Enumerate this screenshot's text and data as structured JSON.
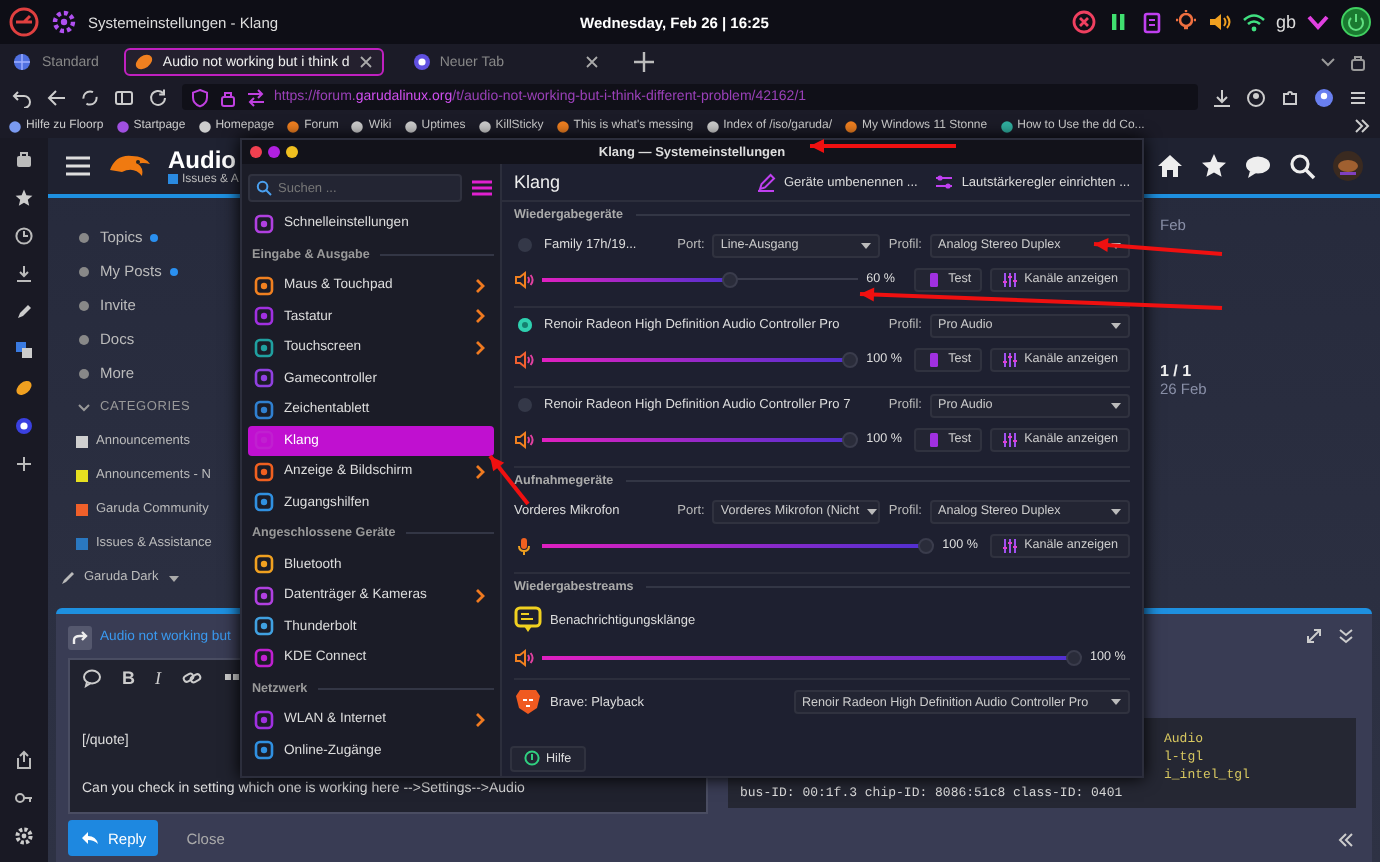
{
  "top_panel": {
    "window_title": "Systemeinstellungen - Klang",
    "clock": "Wednesday, Feb 26 | 16:25",
    "keyboard_layout": "gb"
  },
  "workspace": "Standard",
  "browser_tabs": [
    {
      "label": "Audio not working but i think d",
      "selected": true
    },
    {
      "label": "Neuer Tab",
      "selected": false
    }
  ],
  "address_bar": {
    "scheme": "https://forum.",
    "domain": "garudalinux.org",
    "path": "/t/audio-not-working-but-i-think-different-problem/42162/1"
  },
  "bookmarks": [
    "Hilfe zu Floorp",
    "Startpage",
    "Homepage",
    "Forum",
    "Wiki",
    "Uptimes",
    "KillSticky",
    "This is what's messing",
    "Index of /iso/garuda/",
    "My Windows 11 Stonne",
    "How to Use the dd Co..."
  ],
  "forum": {
    "topic_title": "Audio",
    "category": "Issues & A",
    "nav": [
      {
        "label": "Topics",
        "unread": true
      },
      {
        "label": "My Posts",
        "unread": true
      },
      {
        "label": "Invite",
        "unread": false
      },
      {
        "label": "Docs",
        "unread": false
      },
      {
        "label": "More",
        "unread": false
      }
    ],
    "categories_heading": "CATEGORIES",
    "categories": [
      {
        "name": "Announcements",
        "color": "#cfcfcf"
      },
      {
        "name": "Announcements - N",
        "color": "#e6e020"
      },
      {
        "name": "Garuda Community",
        "color": "#f0602a"
      },
      {
        "name": "Issues & Assistance",
        "color": "#2a78c0"
      }
    ],
    "theme": "Garuda Dark",
    "timeline": {
      "date_top": "Feb",
      "position": "1 / 1",
      "date_bottom": "26 Feb"
    }
  },
  "composer": {
    "reply_title": "Audio not working but",
    "format_buttons": [
      "B",
      "I"
    ],
    "lines": [
      "[/quote]",
      "Can you check in setting which one is working here -->Settings-->Audio"
    ],
    "reply": "Reply",
    "close": "Close",
    "preview_fragments": [
      "Audio",
      "l-tgl",
      "i_intel_tgl"
    ],
    "preview_line": "bus-ID: 00:1f.3 chip-ID: 8086:51c8 class-ID: 0401"
  },
  "settings_window": {
    "title": "Klang — Systemeinstellungen",
    "search_placeholder": "Suchen ...",
    "sidebar": [
      {
        "kind": "item",
        "label": "Schnelleinstellungen",
        "selected": false,
        "submenu": false
      },
      {
        "kind": "heading",
        "label": "Eingabe & Ausgabe"
      },
      {
        "kind": "item",
        "label": "Maus & Touchpad",
        "selected": false,
        "submenu": true
      },
      {
        "kind": "item",
        "label": "Tastatur",
        "selected": false,
        "submenu": true
      },
      {
        "kind": "item",
        "label": "Touchscreen",
        "selected": false,
        "submenu": true
      },
      {
        "kind": "item",
        "label": "Gamecontroller",
        "selected": false,
        "submenu": false
      },
      {
        "kind": "item",
        "label": "Zeichentablett",
        "selected": false,
        "submenu": false
      },
      {
        "kind": "item",
        "label": "Klang",
        "selected": true,
        "submenu": false
      },
      {
        "kind": "item",
        "label": "Anzeige & Bildschirm",
        "selected": false,
        "submenu": true
      },
      {
        "kind": "item",
        "label": "Zugangshilfen",
        "selected": false,
        "submenu": false
      },
      {
        "kind": "heading",
        "label": "Angeschlossene Geräte"
      },
      {
        "kind": "item",
        "label": "Bluetooth",
        "selected": false,
        "submenu": false
      },
      {
        "kind": "item",
        "label": "Datenträger & Kameras",
        "selected": false,
        "submenu": true
      },
      {
        "kind": "item",
        "label": "Thunderbolt",
        "selected": false,
        "submenu": false
      },
      {
        "kind": "item",
        "label": "KDE Connect",
        "selected": false,
        "submenu": false
      },
      {
        "kind": "heading",
        "label": "Netzwerk"
      },
      {
        "kind": "item",
        "label": "WLAN & Internet",
        "selected": false,
        "submenu": true
      },
      {
        "kind": "item",
        "label": "Online-Zugänge",
        "selected": false,
        "submenu": false
      }
    ],
    "page_title": "Klang",
    "actions": [
      "Geräte umbenennen ...",
      "Lautstärkeregler einrichten ..."
    ],
    "sections": [
      {
        "heading": "Wiedergabegeräte",
        "items": [
          {
            "kind": "output-device",
            "name": "Family 17h/19...",
            "selected": false,
            "port_label": "Port:",
            "port": "Line-Ausgang",
            "profile_label": "Profil:",
            "profile": "Analog Stereo Duplex",
            "level": 0.6,
            "reading": "60 %",
            "test": "Test",
            "channels": "Kanäle anzeigen"
          },
          {
            "kind": "output-device",
            "name": "Renoir Radeon High Definition Audio Controller Pro",
            "selected": true,
            "profile_label": "Profil:",
            "profile": "Pro Audio",
            "level": 1,
            "reading": "100 %",
            "test": "Test",
            "channels": "Kanäle anzeigen"
          },
          {
            "kind": "output-device",
            "name": "Renoir Radeon High Definition Audio Controller Pro 7",
            "selected": false,
            "profile_label": "Profil:",
            "profile": "Pro Audio",
            "level": 1,
            "reading": "100 %",
            "test": "Test",
            "channels": "Kanäle anzeigen"
          }
        ]
      },
      {
        "heading": "Aufnahmegeräte",
        "items": [
          {
            "kind": "input-device",
            "name": "Vorderes Mikrofon",
            "port_label": "Port:",
            "port": "Vorderes Mikrofon (Nicht",
            "profile_label": "Profil:",
            "profile": "Analog Stereo Duplex",
            "level": 1,
            "reading": "100 %",
            "channels": "Kanäle anzeigen"
          }
        ]
      },
      {
        "heading": "Wiedergabestreams",
        "items": [
          {
            "kind": "stream-volume",
            "name": "Benachrichtigungsklänge",
            "level": 1,
            "reading": "100 %"
          },
          {
            "kind": "stream-output",
            "name": "Brave: Playback",
            "device": "Renoir Radeon High Definition Audio Controller Pro"
          }
        ]
      }
    ],
    "help": "Hilfe"
  }
}
